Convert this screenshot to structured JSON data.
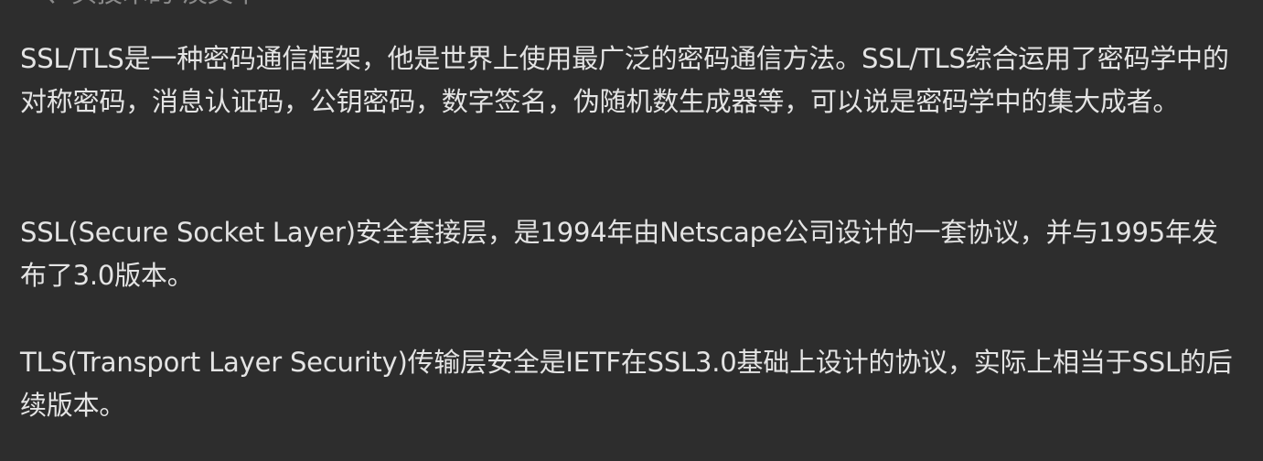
{
  "article": {
    "heading_fragment": "一、头技术的·淡文本",
    "paragraphs": [
      "SSL/TLS是一种密码通信框架，他是世界上使用最广泛的密码通信方法。SSL/TLS综合运用了密码学中的对称密码，消息认证码，公钥密码，数字签名，伪随机数生成器等，可以说是密码学中的集大成者。",
      "SSL(Secure Socket Layer)安全套接层，是1994年由Netscape公司设计的一套协议，并与1995年发布了3.0版本。",
      "TLS(Transport Layer Security)传输层安全是IETF在SSL3.0基础上设计的协议，实际上相当于SSL的后续版本。"
    ]
  }
}
